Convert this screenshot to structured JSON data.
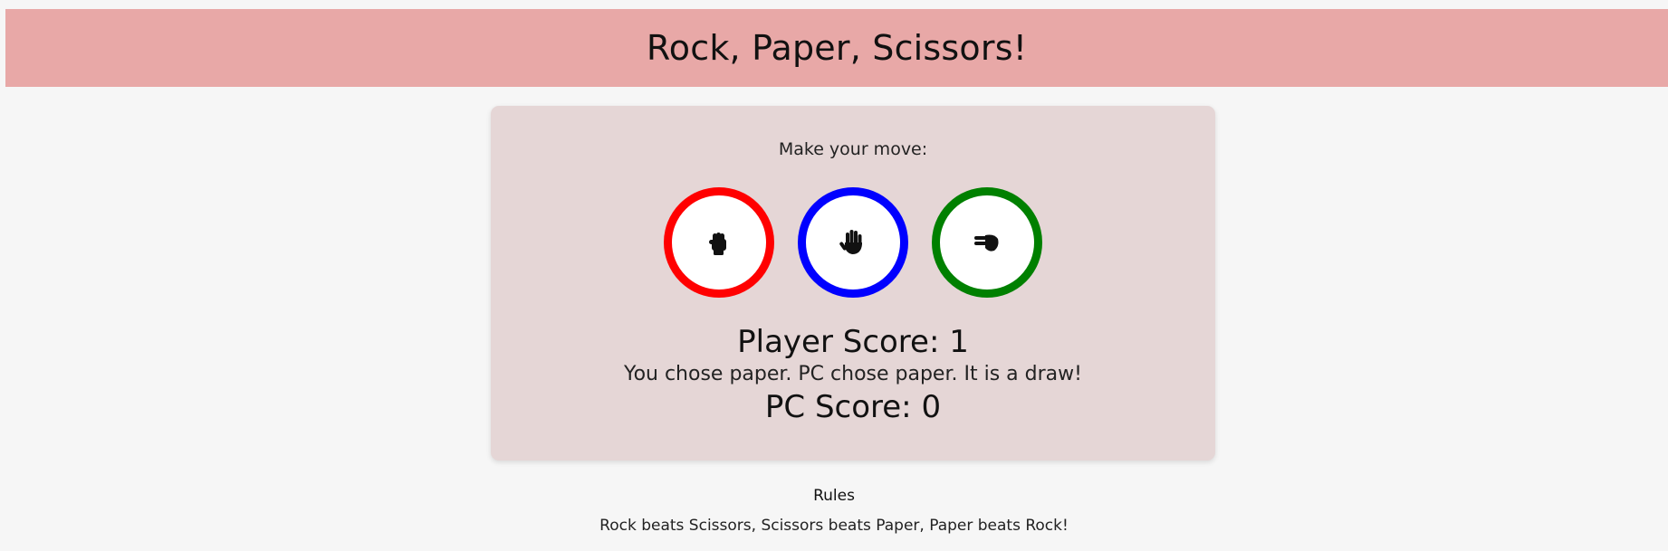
{
  "header": {
    "title": "Rock, Paper, Scissors!"
  },
  "game": {
    "prompt": "Make your move:",
    "choices": [
      {
        "id": "rock",
        "icon": "fist-icon",
        "color": "#ff0000"
      },
      {
        "id": "paper",
        "icon": "open-hand-icon",
        "color": "#0000ff"
      },
      {
        "id": "scissors",
        "icon": "scissors-hand-icon",
        "color": "#008000"
      }
    ],
    "player_score": "Player Score: 1",
    "result": "You chose paper. PC chose paper. It is a draw!",
    "pc_score": "PC Score: 0"
  },
  "rules": {
    "title": "Rules",
    "text": "Rock beats Scissors, Scissors beats Paper, Paper beats Rock!"
  }
}
